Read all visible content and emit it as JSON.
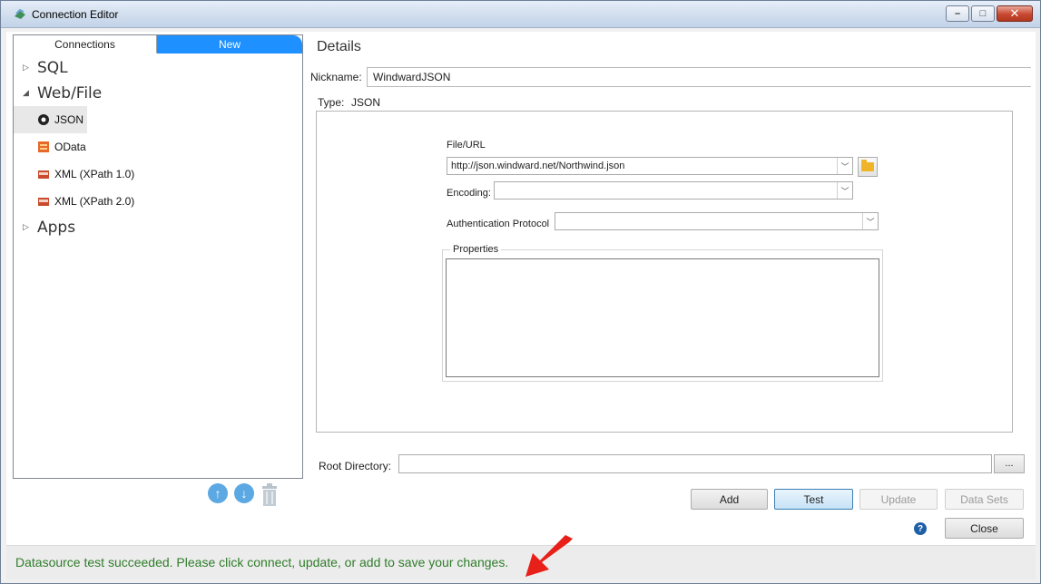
{
  "window": {
    "title": "Connection Editor"
  },
  "tabs": [
    {
      "label": "Connections"
    },
    {
      "label": "New"
    }
  ],
  "tree": {
    "groups": [
      {
        "label": "SQL",
        "expanded": false
      },
      {
        "label": "Web/File",
        "expanded": true
      },
      {
        "label": "Apps",
        "expanded": false
      }
    ],
    "items": [
      {
        "label": "JSON",
        "icon": "json-icon",
        "selected": true
      },
      {
        "label": "OData",
        "icon": "odata-icon",
        "selected": false
      },
      {
        "label": "XML (XPath 1.0)",
        "icon": "xml-icon",
        "selected": false
      },
      {
        "label": "XML (XPath 2.0)",
        "icon": "xml-icon",
        "selected": false
      }
    ]
  },
  "details": {
    "title": "Details",
    "nickname_label": "Nickname:",
    "nickname_value": "WindwardJSON",
    "type_label": "Type:",
    "type_value": "JSON",
    "file_url_label": "File/URL",
    "file_url_value": "http://json.windward.net/Northwind.json",
    "encoding_label": "Encoding:",
    "encoding_value": "",
    "auth_label": "Authentication Protocol",
    "auth_value": "",
    "properties_label": "Properties",
    "root_dir_label": "Root Directory:",
    "root_dir_value": "",
    "browse_label": "..."
  },
  "buttons": {
    "add": "Add",
    "test": "Test",
    "update": "Update",
    "data_sets": "Data Sets",
    "close": "Close",
    "help": "?"
  },
  "status": {
    "message": "Datasource test succeeded. Please click connect, update, or add to save your changes.",
    "color": "#2f7d2a"
  },
  "colors": {
    "accent": "#1e90ff",
    "arrow": "#e8201a"
  }
}
